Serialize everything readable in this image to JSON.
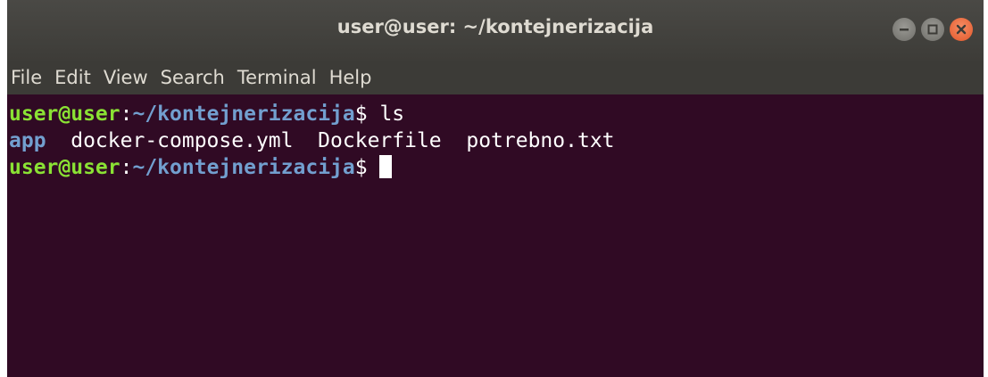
{
  "window": {
    "title": "user@user: ~/kontejnerizacija",
    "controls": [
      "minimize-icon",
      "maximize-icon",
      "close-icon"
    ]
  },
  "menu": {
    "items": [
      {
        "label": "File"
      },
      {
        "label": "Edit"
      },
      {
        "label": "View"
      },
      {
        "label": "Search"
      },
      {
        "label": "Terminal"
      },
      {
        "label": "Help"
      }
    ]
  },
  "terminal": {
    "line1": {
      "user": "user@user",
      "colon": ":",
      "path": "~/kontejnerizacija",
      "symbol": "$",
      "command": " ls"
    },
    "line2": {
      "dir": "app",
      "files": "  docker-compose.yml  Dockerfile  potrebno.txt",
      "gap": "  "
    },
    "line3": {
      "user": "user@user",
      "colon": ":",
      "path": "~/kontejnerizacija",
      "symbol": "$ "
    }
  },
  "colors": {
    "background": "#300a24",
    "prompt_user": "#8ae234",
    "prompt_path": "#729fcf",
    "close_button": "#e2572a"
  }
}
